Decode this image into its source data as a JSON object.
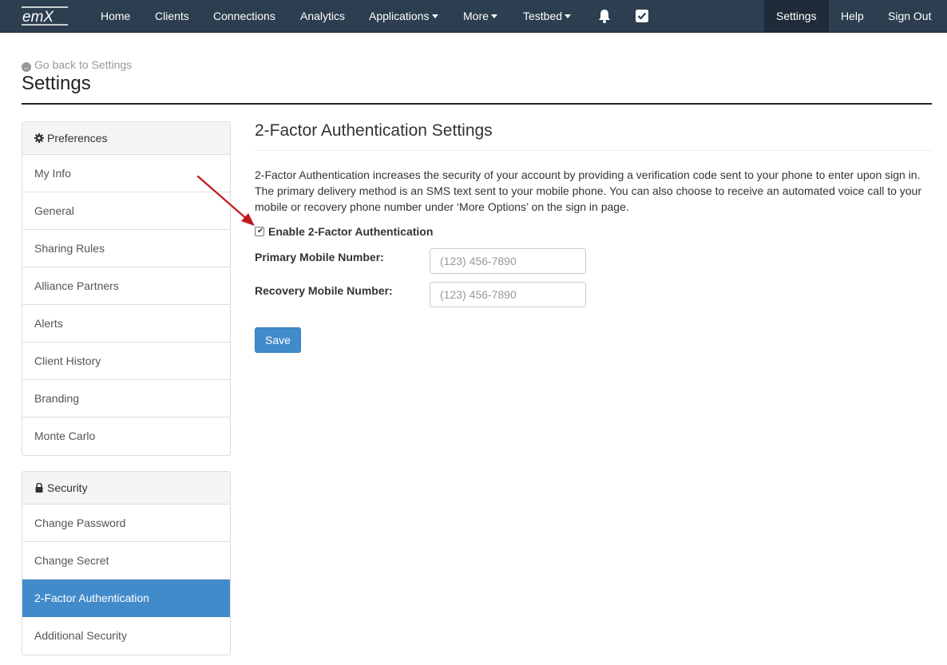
{
  "navbar": {
    "logo_text": "emX",
    "items": [
      {
        "label": "Home"
      },
      {
        "label": "Clients"
      },
      {
        "label": "Connections"
      },
      {
        "label": "Analytics"
      },
      {
        "label": "Applications",
        "dropdown": true
      },
      {
        "label": "More",
        "dropdown": true
      },
      {
        "label": "Testbed",
        "dropdown": true
      }
    ],
    "icons": [
      "bell-icon",
      "checkbox-icon"
    ],
    "right_items": [
      {
        "label": "Settings",
        "active": true
      },
      {
        "label": "Help"
      },
      {
        "label": "Sign Out"
      }
    ],
    "bg_color": "#2c3e50"
  },
  "header": {
    "back_link": "Go back to Settings",
    "title": "Settings"
  },
  "sidebar": {
    "preferences": {
      "heading": "Preferences",
      "icon": "gear-icon",
      "items": [
        {
          "label": "My Info"
        },
        {
          "label": "General"
        },
        {
          "label": "Sharing Rules"
        },
        {
          "label": "Alliance Partners"
        },
        {
          "label": "Alerts"
        },
        {
          "label": "Client History"
        },
        {
          "label": "Branding"
        },
        {
          "label": "Monte Carlo"
        }
      ]
    },
    "security": {
      "heading": "Security",
      "icon": "lock-icon",
      "items": [
        {
          "label": "Change Password"
        },
        {
          "label": "Change Secret"
        },
        {
          "label": "2-Factor Authentication",
          "active": true
        },
        {
          "label": "Additional Security"
        }
      ]
    },
    "active_color": "#428bca"
  },
  "main": {
    "title": "2-Factor Authentication Settings",
    "description": "2-Factor Authentication increases the security of your account by providing a verification code sent to your phone to enter upon sign in. The primary delivery method is an SMS text sent to your mobile phone. You can also choose to receive an automated voice call to your mobile or recovery phone number under ‘More Options’ on the sign in page.",
    "enable_label": "Enable 2-Factor Authentication",
    "enable_checked": true,
    "primary_label": "Primary Mobile Number:",
    "primary_placeholder": "(123) 456-7890",
    "recovery_label": "Recovery Mobile Number:",
    "recovery_placeholder": "(123) 456-7890",
    "save_label": "Save",
    "annotation_arrow_color": "#c0191e"
  }
}
